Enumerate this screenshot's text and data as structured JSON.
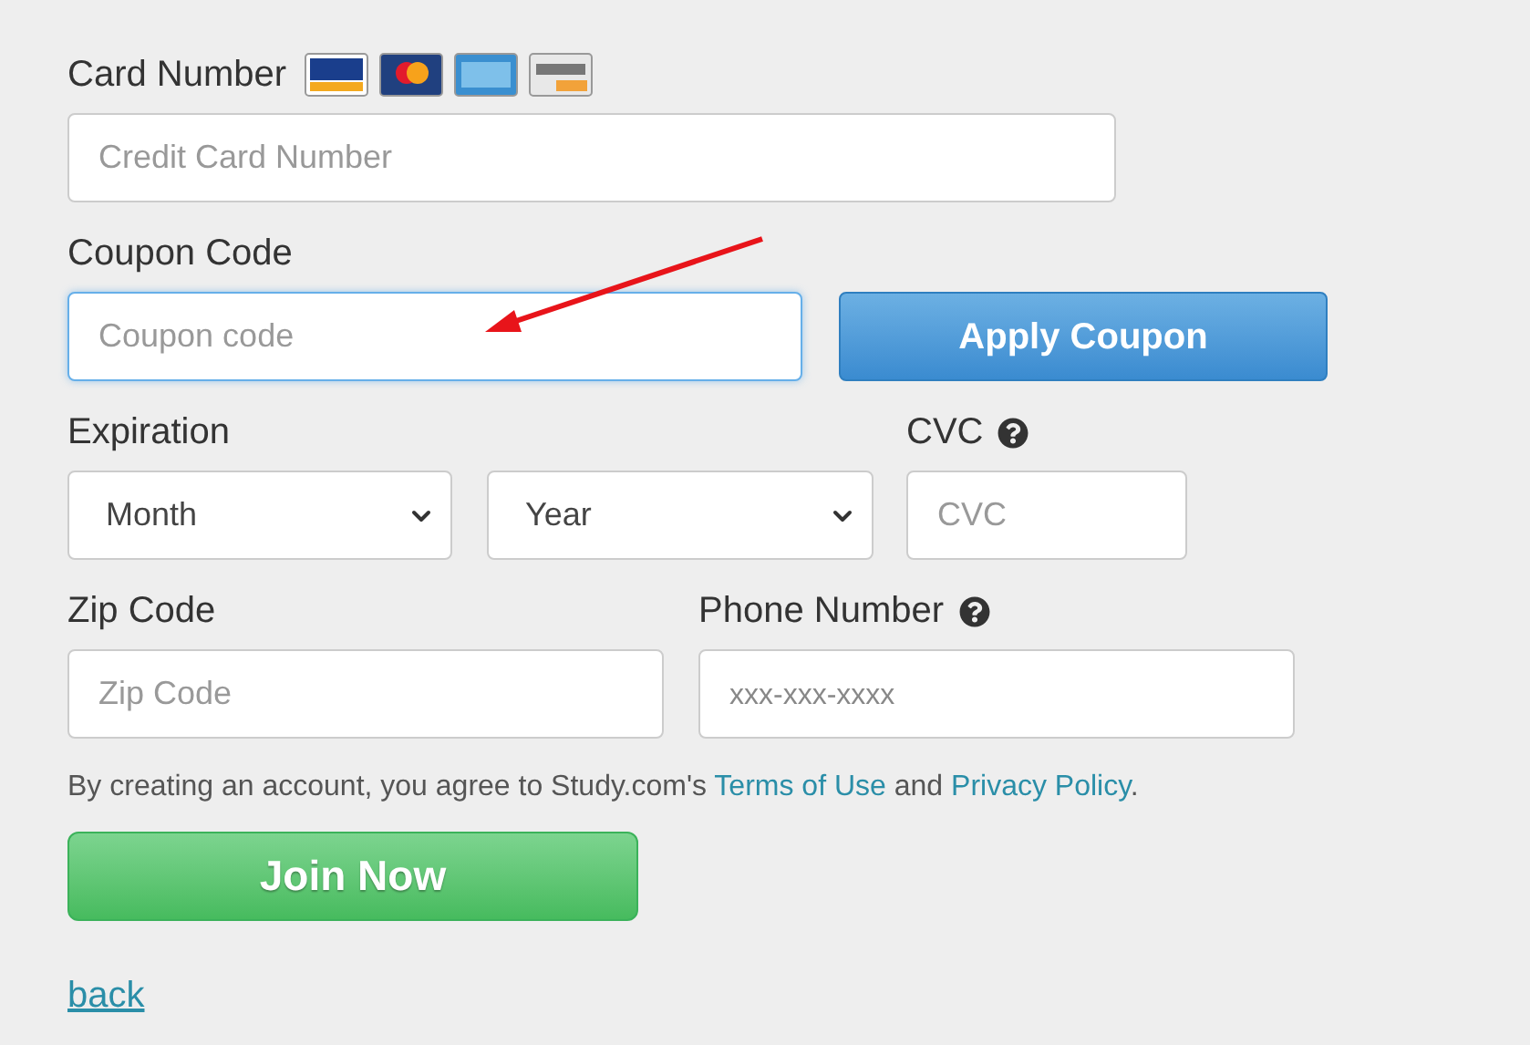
{
  "card_number": {
    "label": "Card Number",
    "placeholder": "Credit Card Number"
  },
  "coupon": {
    "label": "Coupon Code",
    "placeholder": "Coupon code",
    "focused": true,
    "button": "Apply Coupon"
  },
  "expiration": {
    "label": "Expiration",
    "month": "Month",
    "year": "Year"
  },
  "cvc": {
    "label": "CVC",
    "placeholder": "CVC"
  },
  "zip": {
    "label": "Zip Code",
    "placeholder": "Zip Code"
  },
  "phone": {
    "label": "Phone Number",
    "placeholder": "xxx-xxx-xxxx"
  },
  "terms": {
    "before": "By creating an account, you agree to Study.com's",
    "link_1": "Terms of Use",
    "middle": "and",
    "link_2": "Privacy Policy",
    "after": "."
  },
  "join_button": "Join Now",
  "back_link": "back"
}
